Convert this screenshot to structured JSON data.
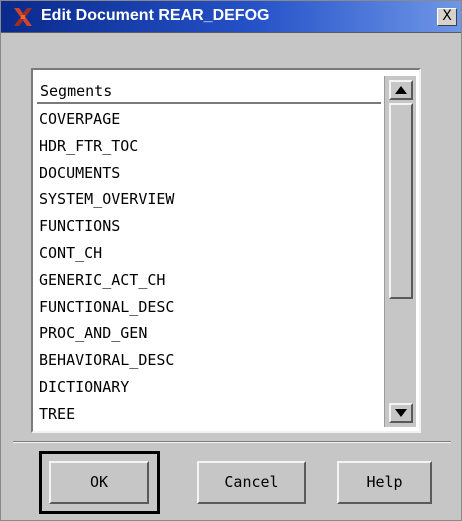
{
  "window": {
    "title": "Edit Document REAR_DEFOG",
    "close_label": "X",
    "icon": "x-app-icon",
    "title_color": "#1a3fa8"
  },
  "segments": {
    "header": "Segments",
    "items": [
      "COVERPAGE",
      "HDR_FTR_TOC",
      "DOCUMENTS",
      "SYSTEM_OVERVIEW",
      "FUNCTIONS",
      "CONT_CH",
      "GENERIC_ACT_CH",
      "FUNCTIONAL_DESC",
      "PROC_AND_GEN",
      "BEHAVIORAL_DESC",
      "DICTIONARY",
      "TREE"
    ]
  },
  "buttons": {
    "ok": "OK",
    "cancel": "Cancel",
    "help": "Help"
  }
}
